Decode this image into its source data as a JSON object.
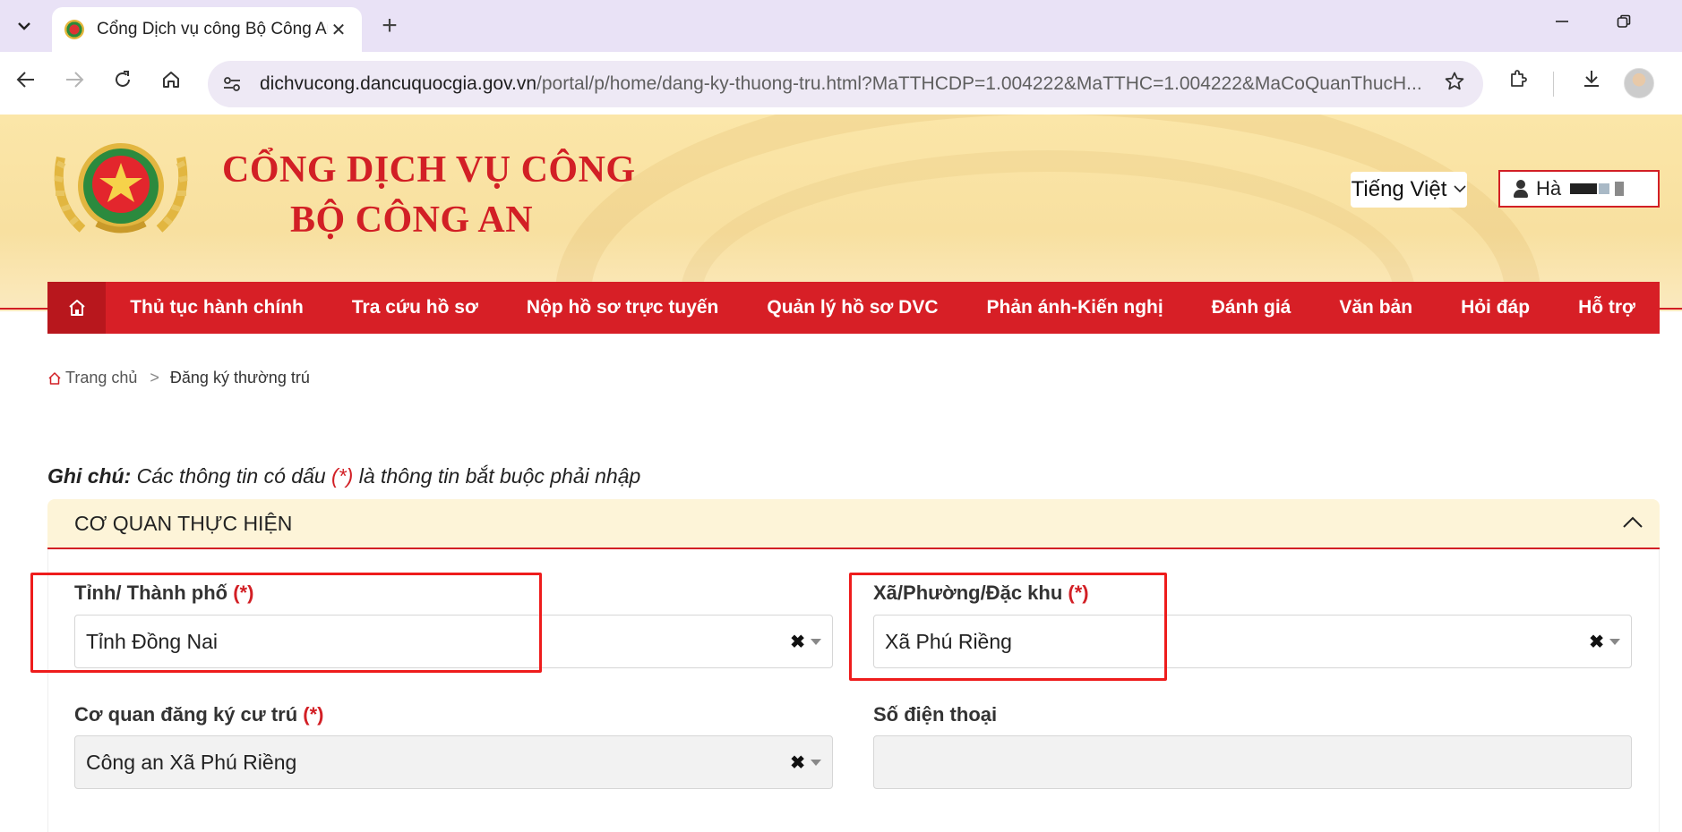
{
  "browser": {
    "tab_title": "Cổng Dịch vụ công Bộ Công An",
    "tab_close": "✕",
    "new_tab": "+",
    "url_host": "dichvucong.dancuquocgia.gov.vn",
    "url_rest": "/portal/p/home/dang-ky-thuong-tru.html?MaTTHCDP=1.004222&MaTTHC=1.004222&MaCoQuanThucH...",
    "icons": [
      "tab-list-icon",
      "back-arrow-icon",
      "forward-arrow-icon",
      "reload-icon",
      "home-icon",
      "site-info-icon",
      "bookmark-star-icon",
      "extensions-icon",
      "download-icon",
      "minimize-icon",
      "restore-icon",
      "profile-avatar"
    ]
  },
  "header": {
    "title_line1": "CỔNG DỊCH VỤ CÔNG",
    "title_line2": "BỘ CÔNG AN",
    "language": "Tiếng Việt",
    "user_name": "Hà",
    "brand_red": "#d21f25"
  },
  "nav": {
    "items": [
      "Thủ tục hành chính",
      "Tra cứu hồ sơ",
      "Nộp hồ sơ trực tuyến",
      "Quản lý hồ sơ DVC",
      "Phản ánh-Kiến nghị",
      "Đánh giá",
      "Văn bản",
      "Hỏi đáp",
      "Hỗ trợ"
    ]
  },
  "breadcrumb": {
    "home": "Trang chủ",
    "separator": ">",
    "current": "Đăng ký thường trú"
  },
  "note": {
    "label": "Ghi chú:",
    "text_before": " Các thông tin có dấu ",
    "required_mark": "(*)",
    "text_after": " là thông tin bắt buộc phải nhập"
  },
  "section": {
    "title": "CƠ QUAN THỰC HIỆN",
    "toggle": "︿",
    "fields": {
      "province": {
        "label": "Tỉnh/ Thành phố",
        "required": "(*)",
        "value": "Tỉnh Đồng Nai"
      },
      "ward": {
        "label": "Xã/Phường/Đặc khu",
        "required": "(*)",
        "value": "Xã Phú Riềng"
      },
      "agency": {
        "label": "Cơ quan đăng ký cư trú",
        "required": "(*)",
        "value": "Công an Xã Phú Riềng"
      },
      "phone": {
        "label": "Số điện thoại",
        "value": ""
      }
    },
    "clear_glyph": "✖"
  }
}
